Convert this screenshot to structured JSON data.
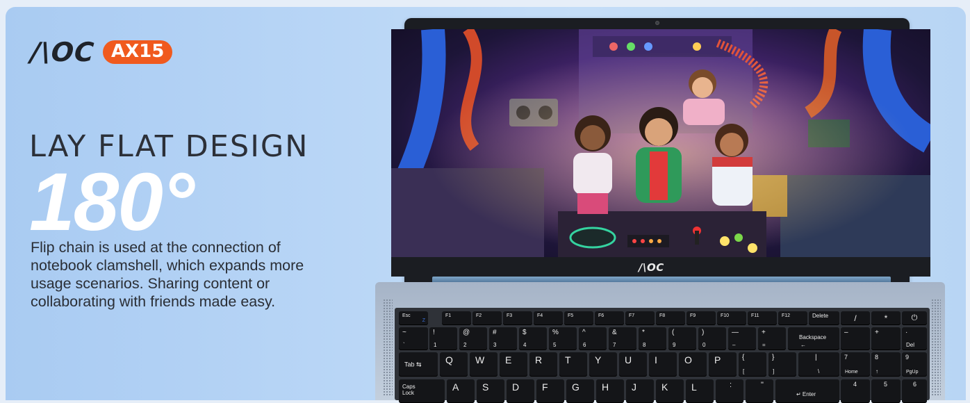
{
  "brand": {
    "logo": "/\\OC",
    "model": "AX15",
    "accent": "#f05a1e"
  },
  "hero": {
    "headline": "LAY FLAT DESIGN",
    "degree": "180°",
    "description": "Flip chain is used at the connection of notebook clamshell, which expands more usage scenarios. Sharing content or collaborating with friends made easy."
  },
  "laptop": {
    "bezel_logo": "/\\OC",
    "screen_art": "children-in-retro-machine-room",
    "keyboard": {
      "row1": [
        {
          "main": "Esc"
        },
        {
          "main": "F1",
          "sub": "Z"
        },
        {
          "main": "F2"
        },
        {
          "main": "F3"
        },
        {
          "main": "F4"
        },
        {
          "main": "F5"
        },
        {
          "main": "F6"
        },
        {
          "main": "F7"
        },
        {
          "main": "F8"
        },
        {
          "main": "F9"
        },
        {
          "main": "F10"
        },
        {
          "main": "F11"
        },
        {
          "main": "F12"
        },
        {
          "main": "Delete"
        },
        {
          "main": "/"
        },
        {
          "main": "*"
        },
        {
          "main": "power-icon"
        }
      ],
      "row2": [
        {
          "top": "~",
          "bot": "`"
        },
        {
          "top": "!",
          "bot": "1"
        },
        {
          "top": "@",
          "bot": "2"
        },
        {
          "top": "#",
          "bot": "3"
        },
        {
          "top": "$",
          "bot": "4"
        },
        {
          "top": "%",
          "bot": "5"
        },
        {
          "top": "^",
          "bot": "6"
        },
        {
          "top": "&",
          "bot": "7"
        },
        {
          "top": "*",
          "bot": "8"
        },
        {
          "top": "(",
          "bot": "9"
        },
        {
          "top": ")",
          "bot": "0"
        },
        {
          "top": "—",
          "bot": "–"
        },
        {
          "top": "+",
          "bot": "="
        },
        {
          "top": "Backspace",
          "bot": "←"
        },
        {
          "top": "–",
          "bot": ""
        },
        {
          "top": "+",
          "bot": ""
        },
        {
          "top": "·",
          "bot": "Del"
        }
      ],
      "row3": [
        {
          "main": "Tab ⇆"
        },
        {
          "main": "Q"
        },
        {
          "main": "W"
        },
        {
          "main": "E"
        },
        {
          "main": "R"
        },
        {
          "main": "T"
        },
        {
          "main": "Y"
        },
        {
          "main": "U"
        },
        {
          "main": "I"
        },
        {
          "main": "O"
        },
        {
          "main": "P"
        },
        {
          "top": "{",
          "bot": "["
        },
        {
          "top": "}",
          "bot": "]"
        },
        {
          "top": "|",
          "bot": "\\"
        },
        {
          "top": "7",
          "bot": "Home"
        },
        {
          "top": "8",
          "bot": "↑"
        },
        {
          "top": "9",
          "bot": "PgUp"
        }
      ],
      "row4": [
        {
          "main": "Caps Lock"
        },
        {
          "main": "A"
        },
        {
          "main": "S"
        },
        {
          "main": "D"
        },
        {
          "main": "F"
        },
        {
          "main": "G"
        },
        {
          "main": "H"
        },
        {
          "main": "J"
        },
        {
          "main": "K"
        },
        {
          "main": "L"
        },
        {
          "top": ":",
          "bot": ";"
        },
        {
          "top": "\"",
          "bot": "'"
        },
        {
          "main": "↵ Enter"
        },
        {
          "top": "4",
          "bot": ""
        },
        {
          "top": "5",
          "bot": ""
        },
        {
          "top": "6",
          "bot": ""
        }
      ]
    }
  }
}
